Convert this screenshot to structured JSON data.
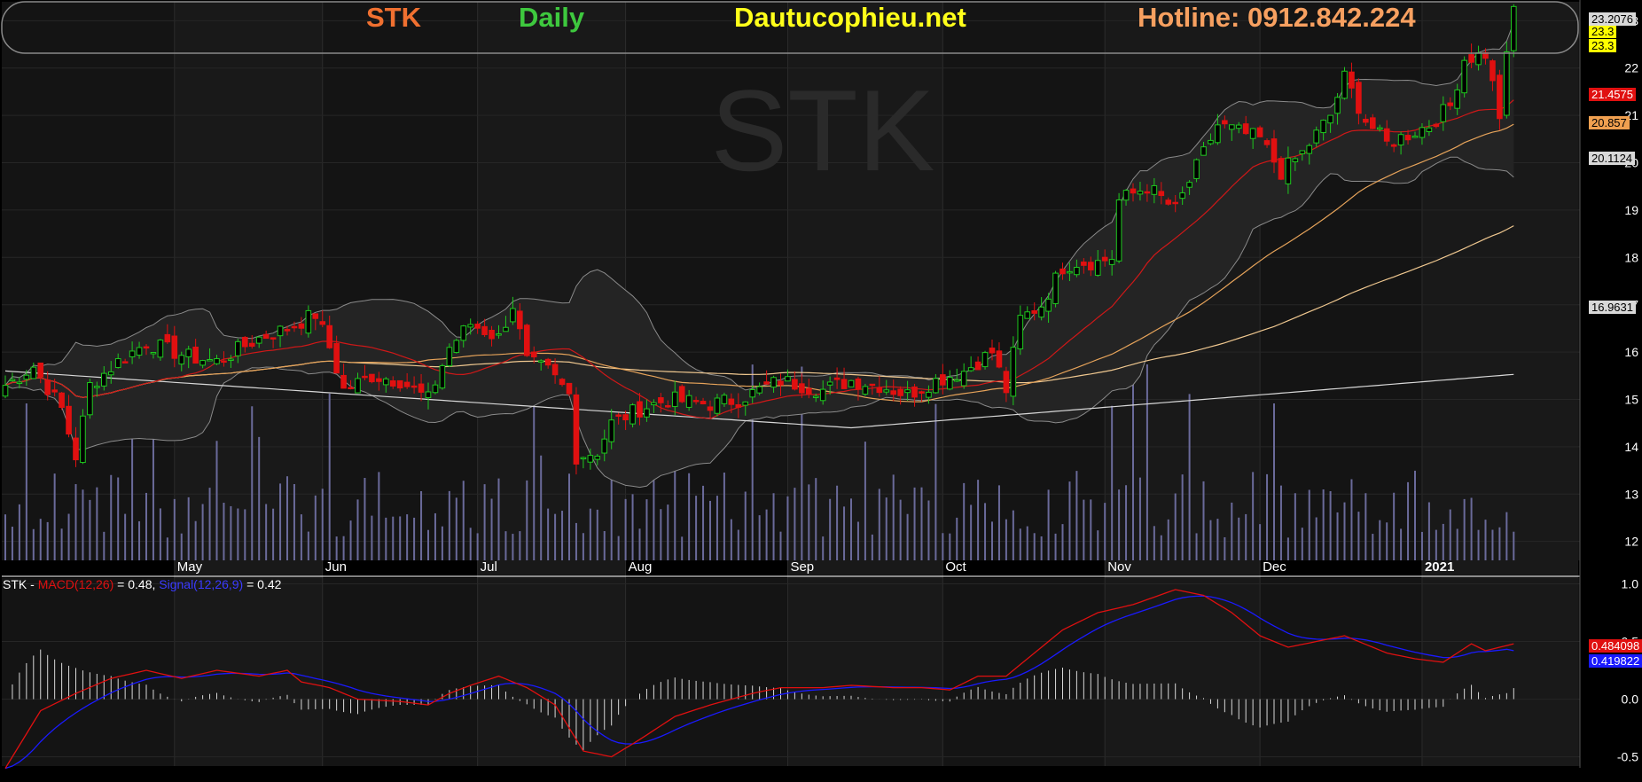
{
  "header": {
    "ticker": "STK",
    "interval": "Daily",
    "site": "Dautucophieu.net",
    "hotline": "Hotline: 0912.842.224",
    "watermark": "STK"
  },
  "colors": {
    "background": "#000000",
    "panel": "#141414",
    "up": "#1ec81e",
    "down": "#e01010",
    "ma_short": "#d01818",
    "ma_mid": "#e6a35a",
    "ma_long": "#f0c890",
    "ma_200": "#d8d8d8",
    "bollinger": "#8a8a8a",
    "volume": "#6a6a9a",
    "macd": "#e01010",
    "signal": "#1a1aff"
  },
  "price_tags": [
    {
      "value": "23.3",
      "bg": "#ffff00",
      "fg": "#000000"
    },
    {
      "value": "23.3",
      "bg": "#ffff00",
      "fg": "#000000"
    },
    {
      "value": "23.2076",
      "bg": "#d8d8d8",
      "fg": "#000000"
    },
    {
      "value": "21.4575",
      "bg": "#e01010",
      "fg": "#ffffff"
    },
    {
      "value": "20.857",
      "bg": "#f0a050",
      "fg": "#000000"
    },
    {
      "value": "20.1124",
      "bg": "#d8d8d8",
      "fg": "#000000"
    },
    {
      "value": "16.9631",
      "bg": "#d8d8d8",
      "fg": "#000000"
    }
  ],
  "macd_tags": [
    {
      "value": "0.484098",
      "bg": "#e01010",
      "fg": "#ffffff"
    },
    {
      "value": "0.419822",
      "bg": "#1a1aff",
      "fg": "#ffffff"
    }
  ],
  "macd_legend": {
    "ticker": "STK",
    "sep": " - ",
    "macd_label": "MACD(12,26)",
    "macd_value": " = 0.48, ",
    "signal_label": "Signal(12,26,9)",
    "signal_value": " = 0.42"
  },
  "chart_data": {
    "type": "candlestick",
    "price_axis": {
      "ticks": [
        "12",
        "13",
        "14",
        "15",
        "16",
        "17",
        "18",
        "19",
        "20",
        "21",
        "22",
        "23"
      ],
      "ylim": [
        11.6,
        23.4
      ]
    },
    "macd_axis": {
      "ticks": [
        "-0.5",
        "0.0",
        "0.5",
        "1.0"
      ],
      "ylim": [
        -0.58,
        1.05
      ]
    },
    "months": [
      "May",
      "Jun",
      "Jul",
      "Aug",
      "Sep",
      "Oct",
      "Nov",
      "Dec",
      "2021"
    ],
    "month_index": [
      24,
      45,
      67,
      88,
      111,
      133,
      156,
      178,
      201
    ],
    "close_anchors": [
      [
        0,
        15.3
      ],
      [
        4,
        15.7
      ],
      [
        8,
        14.8
      ],
      [
        10,
        13.8
      ],
      [
        12,
        15.3
      ],
      [
        16,
        15.8
      ],
      [
        20,
        16.2
      ],
      [
        26,
        15.9
      ],
      [
        30,
        15.8
      ],
      [
        36,
        16.3
      ],
      [
        40,
        16.5
      ],
      [
        44,
        16.8
      ],
      [
        46,
        16.1
      ],
      [
        48,
        15.2
      ],
      [
        52,
        15.5
      ],
      [
        56,
        15.4
      ],
      [
        60,
        15.0
      ],
      [
        63,
        16.1
      ],
      [
        66,
        16.6
      ],
      [
        70,
        16.3
      ],
      [
        72,
        17.0
      ],
      [
        74,
        15.8
      ],
      [
        77,
        15.6
      ],
      [
        80,
        15.1
      ],
      [
        81,
        13.8
      ],
      [
        84,
        13.9
      ],
      [
        86,
        14.5
      ],
      [
        90,
        14.8
      ],
      [
        94,
        15.0
      ],
      [
        100,
        14.9
      ],
      [
        104,
        15.0
      ],
      [
        110,
        15.4
      ],
      [
        116,
        15.2
      ],
      [
        120,
        15.4
      ],
      [
        124,
        15.3
      ],
      [
        128,
        15.1
      ],
      [
        132,
        15.4
      ],
      [
        136,
        15.6
      ],
      [
        140,
        16.0
      ],
      [
        142,
        15.2
      ],
      [
        144,
        16.7
      ],
      [
        147,
        17.0
      ],
      [
        150,
        17.8
      ],
      [
        152,
        17.9
      ],
      [
        155,
        17.9
      ],
      [
        157,
        18.0
      ],
      [
        158,
        19.2
      ],
      [
        162,
        19.5
      ],
      [
        166,
        19.0
      ],
      [
        170,
        20.2
      ],
      [
        172,
        20.8
      ],
      [
        176,
        20.6
      ],
      [
        178,
        20.5
      ],
      [
        181,
        19.8
      ],
      [
        184,
        20.2
      ],
      [
        188,
        21.0
      ],
      [
        190,
        21.8
      ],
      [
        193,
        20.9
      ],
      [
        196,
        20.4
      ],
      [
        199,
        20.6
      ],
      [
        202,
        20.8
      ],
      [
        205,
        21.2
      ],
      [
        207,
        22.2
      ],
      [
        210,
        22.3
      ],
      [
        212,
        21.0
      ],
      [
        213,
        22.2
      ],
      [
        214,
        23.3
      ]
    ],
    "macd_anchors": [
      [
        0,
        -0.6
      ],
      [
        5,
        -0.1
      ],
      [
        10,
        0.05
      ],
      [
        15,
        0.18
      ],
      [
        20,
        0.25
      ],
      [
        25,
        0.18
      ],
      [
        30,
        0.25
      ],
      [
        36,
        0.2
      ],
      [
        40,
        0.25
      ],
      [
        42,
        0.15
      ],
      [
        46,
        0.1
      ],
      [
        50,
        0.0
      ],
      [
        56,
        -0.02
      ],
      [
        60,
        -0.05
      ],
      [
        63,
        0.05
      ],
      [
        66,
        0.12
      ],
      [
        70,
        0.2
      ],
      [
        74,
        0.1
      ],
      [
        78,
        -0.05
      ],
      [
        82,
        -0.45
      ],
      [
        86,
        -0.5
      ],
      [
        90,
        -0.35
      ],
      [
        95,
        -0.15
      ],
      [
        100,
        -0.05
      ],
      [
        106,
        0.05
      ],
      [
        110,
        0.1
      ],
      [
        116,
        0.1
      ],
      [
        120,
        0.12
      ],
      [
        126,
        0.1
      ],
      [
        130,
        0.1
      ],
      [
        134,
        0.08
      ],
      [
        138,
        0.2
      ],
      [
        142,
        0.2
      ],
      [
        146,
        0.4
      ],
      [
        150,
        0.6
      ],
      [
        155,
        0.75
      ],
      [
        160,
        0.82
      ],
      [
        166,
        0.95
      ],
      [
        170,
        0.9
      ],
      [
        174,
        0.75
      ],
      [
        178,
        0.55
      ],
      [
        182,
        0.45
      ],
      [
        186,
        0.5
      ],
      [
        190,
        0.55
      ],
      [
        196,
        0.4
      ],
      [
        200,
        0.35
      ],
      [
        204,
        0.32
      ],
      [
        208,
        0.48
      ],
      [
        210,
        0.42
      ],
      [
        214,
        0.48
      ]
    ],
    "macd_value": 0.48,
    "signal_value": 0.42,
    "last_close": 23.3,
    "moving_averages": [
      21.4575,
      20.857,
      16.9631
    ],
    "bollinger": [
      23.2076,
      20.1124
    ]
  }
}
